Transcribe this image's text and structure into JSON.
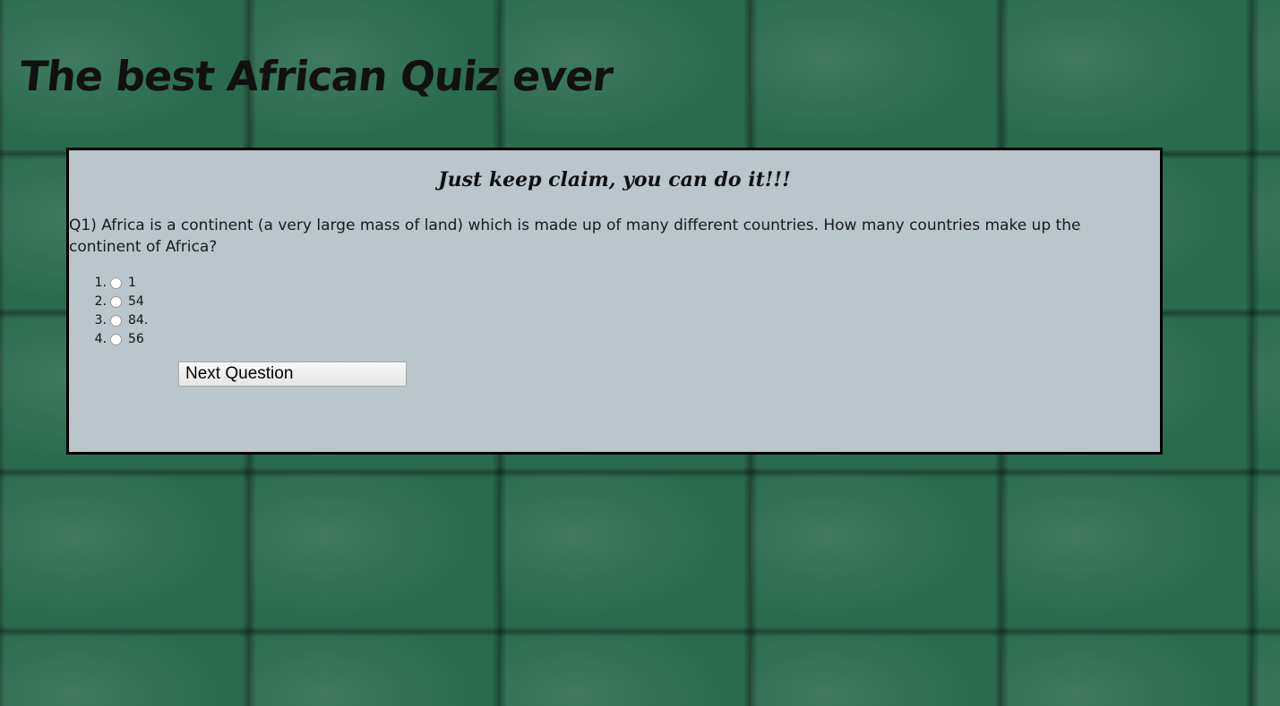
{
  "page": {
    "title": "The best African Quiz ever"
  },
  "panel": {
    "heading": "Just keep claim, you can do it!!!",
    "question": "Q1) Africa is a continent (a very large mass of land) which is made up of many different countries. How many countries make up the continent of Africa?",
    "options": [
      {
        "number": "1.",
        "label": "1"
      },
      {
        "number": "2.",
        "label": "54"
      },
      {
        "number": "3.",
        "label": "84."
      },
      {
        "number": "4.",
        "label": "56"
      }
    ],
    "next_button_label": "Next Question"
  },
  "colors": {
    "background": "#2a6b4f",
    "panel": "#bac5cc",
    "border": "#000000"
  }
}
